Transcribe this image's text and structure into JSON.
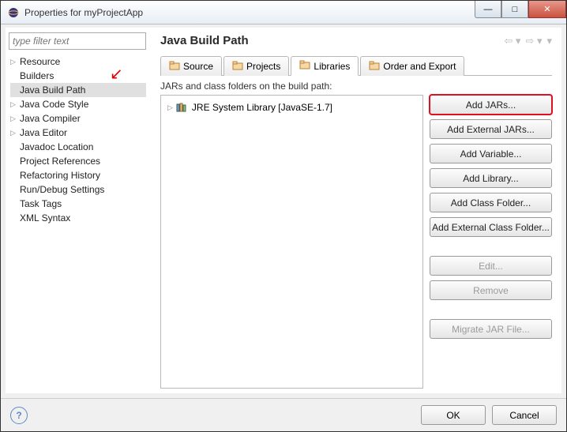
{
  "window": {
    "title": "Properties for myProjectApp"
  },
  "sidebar": {
    "filter_placeholder": "type filter text",
    "items": [
      {
        "label": "Resource",
        "children": true
      },
      {
        "label": "Builders",
        "children": false
      },
      {
        "label": "Java Build Path",
        "children": false,
        "selected": true
      },
      {
        "label": "Java Code Style",
        "children": true
      },
      {
        "label": "Java Compiler",
        "children": true
      },
      {
        "label": "Java Editor",
        "children": true
      },
      {
        "label": "Javadoc Location",
        "children": false
      },
      {
        "label": "Project References",
        "children": false
      },
      {
        "label": "Refactoring History",
        "children": false
      },
      {
        "label": "Run/Debug Settings",
        "children": false
      },
      {
        "label": "Task Tags",
        "children": false
      },
      {
        "label": "XML Syntax",
        "children": false
      }
    ]
  },
  "main": {
    "title": "Java Build Path",
    "tabs": [
      {
        "label": "Source",
        "active": false
      },
      {
        "label": "Projects",
        "active": false
      },
      {
        "label": "Libraries",
        "active": true
      },
      {
        "label": "Order and Export",
        "active": false
      }
    ],
    "subheader": "JARs and class folders on the build path:",
    "library_entry": "JRE System Library [JavaSE-1.7]",
    "buttons": [
      {
        "label": "Add JARs...",
        "enabled": true,
        "highlight": true
      },
      {
        "label": "Add External JARs...",
        "enabled": true
      },
      {
        "label": "Add Variable...",
        "enabled": true
      },
      {
        "label": "Add Library...",
        "enabled": true
      },
      {
        "label": "Add Class Folder...",
        "enabled": true
      },
      {
        "label": "Add External Class Folder...",
        "enabled": true
      },
      {
        "label": "Edit...",
        "enabled": false
      },
      {
        "label": "Remove",
        "enabled": false
      },
      {
        "label": "Migrate JAR File...",
        "enabled": false
      }
    ]
  },
  "footer": {
    "ok": "OK",
    "cancel": "Cancel"
  }
}
